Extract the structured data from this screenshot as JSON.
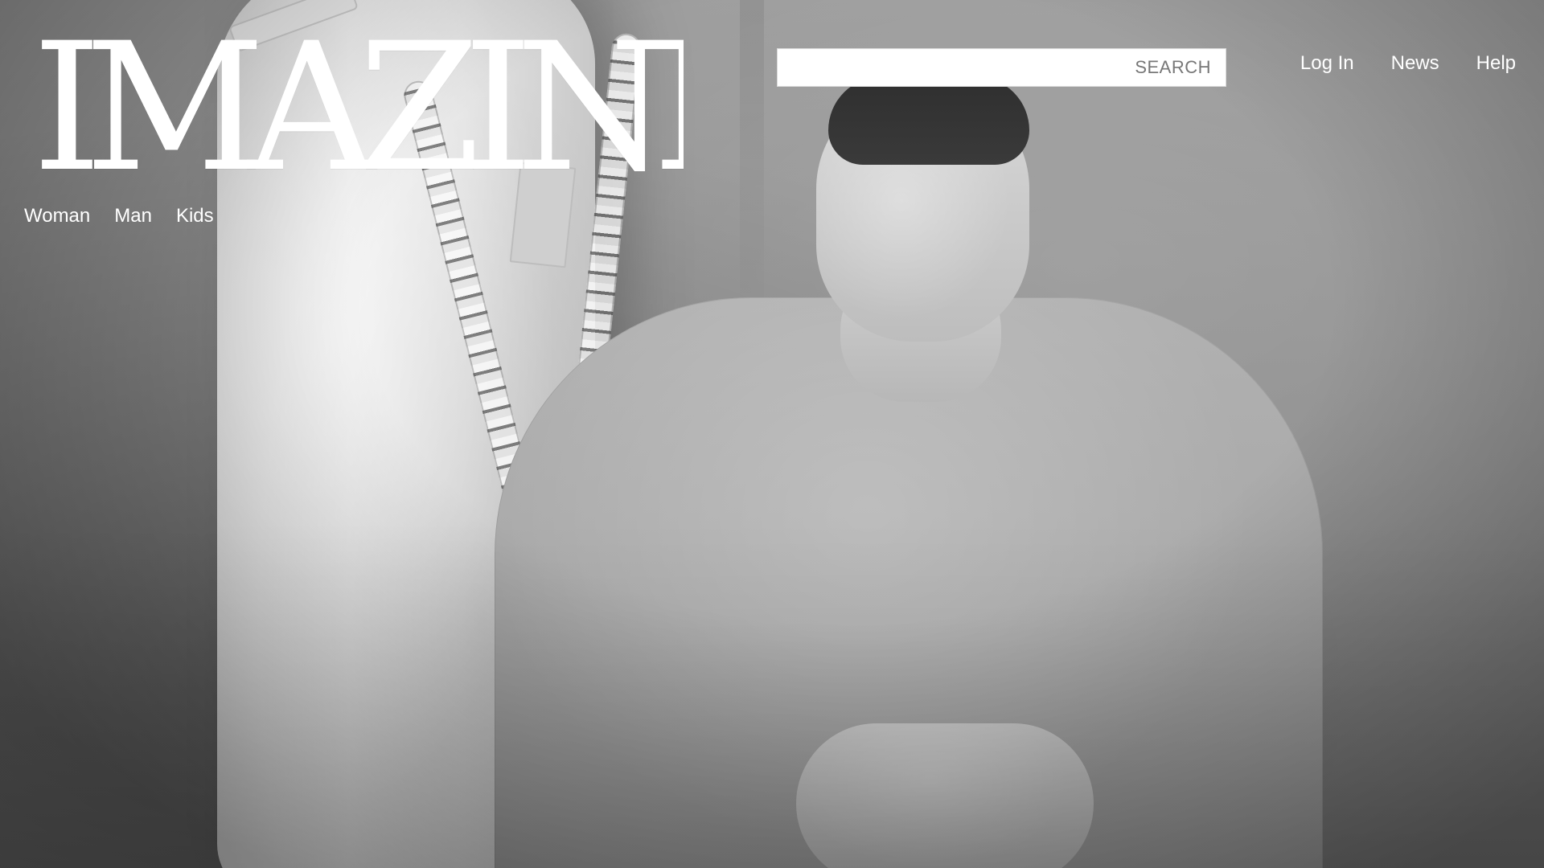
{
  "header": {
    "logo_text": "IMAZINE",
    "search": {
      "label": "SEARCH",
      "value": "",
      "placeholder": ""
    },
    "top_links": {
      "login": "Log In",
      "news": "News",
      "help": "Help"
    },
    "categories": [
      "Woman",
      "Man",
      "Kids"
    ]
  },
  "hero": {
    "image_semantic": "fashion-hero-photo"
  }
}
